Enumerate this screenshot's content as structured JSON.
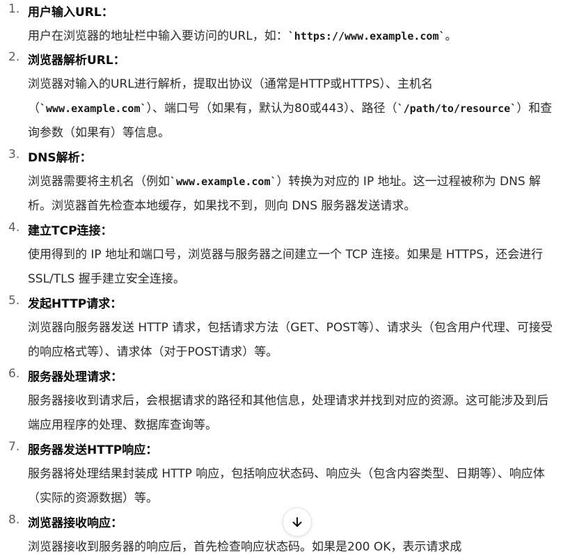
{
  "steps": [
    {
      "num": "1.",
      "title": "用户输入URL：",
      "body": [
        {
          "t": "用户在浏览器的地址栏中输入要访问的URL，如："
        },
        {
          "t": "`https://www.example.com`",
          "code": true
        },
        {
          "t": "。"
        }
      ]
    },
    {
      "num": "2.",
      "title": "浏览器解析URL：",
      "body": [
        {
          "t": "浏览器对输入的URL进行解析，提取出协议（通常是HTTP或HTTPS）、主机名（"
        },
        {
          "t": "`www.example.com`",
          "code": true
        },
        {
          "t": "）、端口号（如果有，默认为80或443）、路径（"
        },
        {
          "t": "`/path/to/resource`",
          "code": true
        },
        {
          "t": "）和查询参数（如果有）等信息。"
        }
      ]
    },
    {
      "num": "3.",
      "title": "DNS解析：",
      "body": [
        {
          "t": "浏览器需要将主机名（例如"
        },
        {
          "t": "`www.example.com`",
          "code": true
        },
        {
          "t": "）转换为对应的 IP 地址。这一过程被称为 DNS 解析。浏览器首先检查本地缓存，如果找不到，则向 DNS 服务器发送请求。"
        }
      ]
    },
    {
      "num": "4.",
      "title": "建立TCP连接：",
      "body": [
        {
          "t": "使用得到的 IP 地址和端口号，浏览器与服务器之间建立一个 TCP 连接。如果是 HTTPS，还会进行 SSL/TLS 握手建立安全连接。"
        }
      ]
    },
    {
      "num": "5.",
      "title": "发起HTTP请求：",
      "body": [
        {
          "t": "浏览器向服务器发送 HTTP 请求，包括请求方法（GET、POST等）、请求头（包含用户代理、可接受的响应格式等）、请求体（对于POST请求）等。"
        }
      ]
    },
    {
      "num": "6.",
      "title": "服务器处理请求：",
      "body": [
        {
          "t": "服务器接收到请求后，会根据请求的路径和其他信息，处理请求并找到对应的资源。这可能涉及到后端应用程序的处理、数据库查询等。"
        }
      ]
    },
    {
      "num": "7.",
      "title": "服务器发送HTTP响应：",
      "body": [
        {
          "t": "服务器将处理结果封装成 HTTP 响应，包括响应状态码、响应头（包含内容类型、日期等）、响应体（实际的资源数据）等。"
        }
      ]
    },
    {
      "num": "8.",
      "title": "浏览器接收响应：",
      "body": [
        {
          "t": "浏览器接收到服务器的响应后，首先检查响应状态码。如果是200 OK，表示请求成"
        }
      ]
    }
  ],
  "scroll_button": {
    "icon": "arrow-down-icon"
  }
}
